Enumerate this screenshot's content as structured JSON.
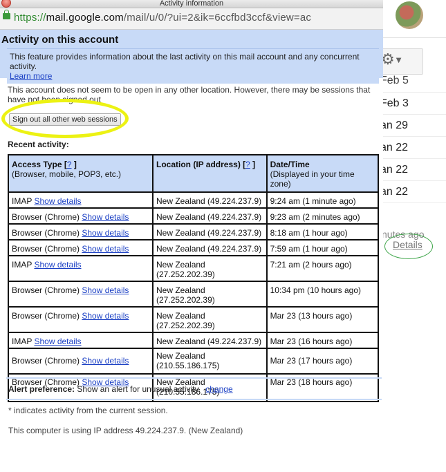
{
  "window": {
    "title": "Activity information"
  },
  "url": {
    "scheme": "https://",
    "host": "mail.google.com",
    "path": "/mail/u/0/?ui=2&ik=6ccfbd3ccf&view=ac"
  },
  "banner": {
    "heading": "Activity on this account",
    "text": "This feature provides information about the last activity on this mail account and any concurrent activity.",
    "learn_more": "Learn more"
  },
  "notice": "This account does not seem to be open in any other location. However, there may be sessions that have not been signed out",
  "signout_button": "Sign out all other web sessions",
  "recent_heading": "Recent activity:",
  "table": {
    "headers": {
      "access_type": "Access Type [",
      "access_type_help": "?",
      "access_type_close": " ]",
      "access_type_sub": "(Browser, mobile, POP3, etc.)",
      "location": "Location (IP address) [",
      "location_help": "?",
      "location_close": " ]",
      "datetime": "Date/Time",
      "datetime_sub": "(Displayed in your time zone)"
    },
    "rows": [
      {
        "type": "IMAP",
        "link": "Show details",
        "location": "New Zealand (49.224.237.9)",
        "time": "9:24 am (1 minute ago)"
      },
      {
        "type": "Browser (Chrome)",
        "link": "Show details",
        "location": "New Zealand (49.224.237.9)",
        "time": "9:23 am (2 minutes ago)"
      },
      {
        "type": "Browser (Chrome)",
        "link": "Show details",
        "location": "New Zealand (49.224.237.9)",
        "time": "8:18 am (1 hour ago)"
      },
      {
        "type": "Browser (Chrome)",
        "link": "Show details",
        "location": "New Zealand (49.224.237.9)",
        "time": "7:59 am (1 hour ago)"
      },
      {
        "type": "IMAP",
        "link": "Show details",
        "location": "New Zealand (27.252.202.39)",
        "time": "7:21 am (2 hours ago)"
      },
      {
        "type": "Browser (Chrome)",
        "link": "Show details",
        "location": "New Zealand (27.252.202.39)",
        "time": "10:34 pm (10 hours ago)"
      },
      {
        "type": "Browser (Chrome)",
        "link": "Show details",
        "location": "New Zealand (27.252.202.39)",
        "time": "Mar 23 (13 hours ago)"
      },
      {
        "type": "IMAP",
        "link": "Show details",
        "location": "New Zealand (49.224.237.9)",
        "time": "Mar 23 (16 hours ago)"
      },
      {
        "type": "Browser (Chrome)",
        "link": "Show details",
        "location_line1": "New Zealand",
        "location_line2": "(210.55.186.175)",
        "time": "Mar 23 (17 hours ago)"
      },
      {
        "type": "Browser (Chrome)",
        "link": "Show details",
        "location_line1": "New Zealand",
        "location_line2": "(210.55.186.175)",
        "time": "Mar 23 (18 hours ago)"
      }
    ]
  },
  "alert_pref": {
    "label": "Alert preference:",
    "text": "Show an alert for unusual activity.",
    "change": "change"
  },
  "footnote": "* indicates activity from the current session.",
  "ip_note": "This computer is using IP address 49.224.237.9. (New Zealand)",
  "background": {
    "dates": [
      "Feb 5",
      "Feb 3",
      "an 29",
      "an 22",
      "an 22",
      "an 22"
    ],
    "ago": "nutes ago",
    "details": "Details"
  },
  "colors": {
    "banner_bg": "#c8daf7",
    "link": "#1a3fc4",
    "highlight_yellow": "#ecf213",
    "highlight_green": "#3fa64a"
  },
  "icons": {
    "gear": "gear-icon",
    "lock": "lock-icon",
    "close": "close-window-icon"
  }
}
